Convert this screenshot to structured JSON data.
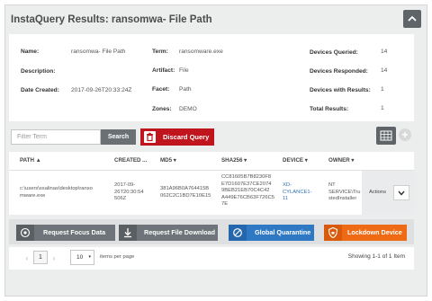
{
  "title": "InstaQuery Results: ransomwa- File Path",
  "summary": {
    "name_label": "Name:",
    "name_value": "ransomwa- File Path",
    "description_label": "Description:",
    "description_value": "",
    "date_created_label": "Date Created:",
    "date_created_value": "2017-09-26T20:33:24Z",
    "term_label": "Term:",
    "term_value": "ransomware.exe",
    "artifact_label": "Artifact:",
    "artifact_value": "File",
    "facet_label": "Facet:",
    "facet_value": "Path",
    "zones_label": "Zones:",
    "zones_value": "DEMO",
    "devices_queried_label": "Devices Queried:",
    "devices_queried_value": "14",
    "devices_responded_label": "Devices Responded:",
    "devices_responded_value": "14",
    "devices_with_results_label": "Devices with Results:",
    "devices_with_results_value": "1",
    "total_results_label": "Total Results:",
    "total_results_value": "1"
  },
  "toolbar": {
    "filter_placeholder": "Filter Term",
    "search_label": "Search",
    "discard_label": "Discard Query"
  },
  "table": {
    "headers": {
      "path": "PATH ▲",
      "created": "CREATED ...",
      "md5": "MD5 ▾",
      "sha256": "SHA256 ▾",
      "device": "DEVICE ▾",
      "owner": "OWNER ▾"
    },
    "row": {
      "path": "c:\\users\\ssalinas\\desktop\\ranso\nmware.exe",
      "created": "2017-09-\n26T20:30:54\n506Z",
      "md5": "381A96B0A764415B\n062C2C1BD7E10E15",
      "sha256": "CC81605B7B8230F8\nE7D1607E37CE2074\n9BEB21EB70C4C42\nA449E76CB63F726C5\n7E",
      "device": "XD-\nCYLANCE1-\n11",
      "owner": "NT\nSERVICE\\Tru\nstedInstaller",
      "actions": "Actions"
    }
  },
  "actions": {
    "focus": "Request Focus Data",
    "download": "Request File Download",
    "quarantine": "Global Quarantine",
    "lockdown": "Lockdown Device"
  },
  "pager": {
    "prev": "‹",
    "page": "1",
    "next": "›",
    "per_page": "10",
    "per_page_label": "items per page",
    "showing": "Showing 1-1 of 1 Item"
  },
  "colors": {
    "discard": "#c0151c",
    "quarantine": "#2f78c4",
    "lockdown": "#ef6a14",
    "device_link": "#2e72b8"
  },
  "icons": [
    "chevron-up-icon",
    "trash-icon",
    "grid-view-icon",
    "plus-icon",
    "chevron-down-icon",
    "eye-icon",
    "download-icon",
    "ban-icon",
    "shield-lock-icon"
  ]
}
